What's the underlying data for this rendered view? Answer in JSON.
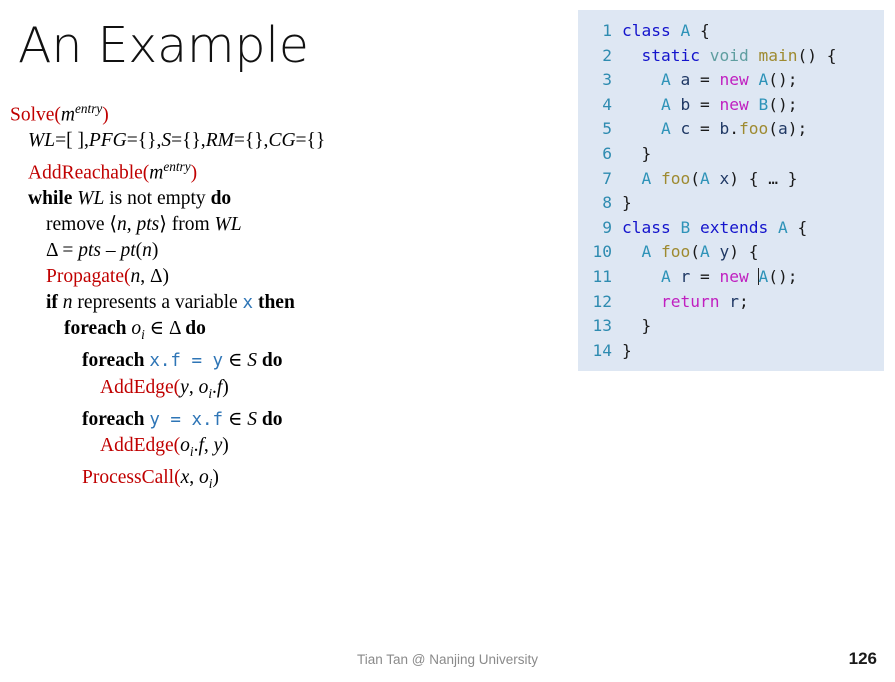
{
  "slide": {
    "title": "An Example",
    "footer": "Tian Tan @ Nanjing University",
    "page_number": "126",
    "colors": {
      "procedure_red": "#C00000",
      "code_blue": "#2E75B6",
      "code_panel_background": "#DEE7F3",
      "line_number": "#2E8BB0",
      "keyword": "#1414CC",
      "type": "#2E93B8",
      "method": "#9E8A30",
      "variable": "#1F3864",
      "new_keyword": "#C020C0",
      "footer_gray": "#8A8A8A"
    }
  },
  "algorithm": {
    "lines": [
      {
        "indent": 0,
        "parts": [
          {
            "text": "Solve(",
            "style": "fn"
          },
          {
            "text": "m",
            "style": "mathvar"
          },
          {
            "text": "entry",
            "style": "sup"
          },
          {
            "text": ")",
            "style": "fn"
          }
        ]
      },
      {
        "indent": 1,
        "parts": [
          {
            "text": "WL",
            "style": "it"
          },
          {
            "text": "=[ ],",
            "style": "plain"
          },
          {
            "text": "PFG",
            "style": "it"
          },
          {
            "text": "={},",
            "style": "plain"
          },
          {
            "text": "S",
            "style": "it"
          },
          {
            "text": "={},",
            "style": "plain"
          },
          {
            "text": "RM",
            "style": "it"
          },
          {
            "text": "={},",
            "style": "plain"
          },
          {
            "text": "CG",
            "style": "it"
          },
          {
            "text": "={}",
            "style": "plain"
          }
        ]
      },
      {
        "indent": 1,
        "parts": [
          {
            "text": "AddReachable(",
            "style": "fn"
          },
          {
            "text": "m",
            "style": "mathvar"
          },
          {
            "text": "entry",
            "style": "sup"
          },
          {
            "text": ")",
            "style": "fn"
          }
        ]
      },
      {
        "indent": 1,
        "parts": [
          {
            "text": "while ",
            "style": "kw"
          },
          {
            "text": "WL",
            "style": "it"
          },
          {
            "text": " is not empty ",
            "style": "plain"
          },
          {
            "text": "do",
            "style": "kw"
          }
        ]
      },
      {
        "indent": 2,
        "parts": [
          {
            "text": "remove ⟨",
            "style": "plain"
          },
          {
            "text": "n",
            "style": "it"
          },
          {
            "text": ", ",
            "style": "plain"
          },
          {
            "text": "pts",
            "style": "it"
          },
          {
            "text": "⟩ from ",
            "style": "plain"
          },
          {
            "text": "WL",
            "style": "it"
          }
        ]
      },
      {
        "indent": 2,
        "parts": [
          {
            "text": "Δ = ",
            "style": "plain"
          },
          {
            "text": "pts",
            "style": "it"
          },
          {
            "text": " – ",
            "style": "plain"
          },
          {
            "text": "pt",
            "style": "it"
          },
          {
            "text": "(",
            "style": "plain"
          },
          {
            "text": "n",
            "style": "it"
          },
          {
            "text": ")",
            "style": "plain"
          }
        ]
      },
      {
        "indent": 2,
        "parts": [
          {
            "text": "Propagate(",
            "style": "fn"
          },
          {
            "text": "n",
            "style": "it"
          },
          {
            "text": ", Δ)",
            "style": "plain"
          }
        ]
      },
      {
        "indent": 2,
        "parts": [
          {
            "text": "if ",
            "style": "kw"
          },
          {
            "text": "n",
            "style": "it"
          },
          {
            "text": " represents a variable ",
            "style": "plain"
          },
          {
            "text": "x",
            "style": "mono"
          },
          {
            "text": " ",
            "style": "plain"
          },
          {
            "text": "then",
            "style": "kw"
          }
        ]
      },
      {
        "indent": 3,
        "parts": [
          {
            "text": "foreach ",
            "style": "kw"
          },
          {
            "text": "o",
            "style": "it"
          },
          {
            "text": "i",
            "style": "sub"
          },
          {
            "text": " ∈ Δ ",
            "style": "plain"
          },
          {
            "text": "do",
            "style": "kw"
          }
        ]
      },
      {
        "indent": 4,
        "parts": [
          {
            "text": "foreach ",
            "style": "kw"
          },
          {
            "text": "x.f = y",
            "style": "mono"
          },
          {
            "text": " ∈ ",
            "style": "plain"
          },
          {
            "text": "S",
            "style": "it"
          },
          {
            "text": " ",
            "style": "plain"
          },
          {
            "text": "do",
            "style": "kw"
          }
        ]
      },
      {
        "indent": 5,
        "parts": [
          {
            "text": "AddEdge(",
            "style": "fn"
          },
          {
            "text": "y",
            "style": "it"
          },
          {
            "text": ", ",
            "style": "plain"
          },
          {
            "text": "o",
            "style": "it"
          },
          {
            "text": "i",
            "style": "sub"
          },
          {
            "text": ".",
            "style": "plain"
          },
          {
            "text": "f",
            "style": "it"
          },
          {
            "text": ")",
            "style": "plain"
          }
        ]
      },
      {
        "indent": 4,
        "parts": [
          {
            "text": "foreach ",
            "style": "kw"
          },
          {
            "text": "y = x.f",
            "style": "mono"
          },
          {
            "text": " ∈ ",
            "style": "plain"
          },
          {
            "text": "S",
            "style": "it"
          },
          {
            "text": " ",
            "style": "plain"
          },
          {
            "text": "do",
            "style": "kw"
          }
        ]
      },
      {
        "indent": 5,
        "parts": [
          {
            "text": "AddEdge(",
            "style": "fn"
          },
          {
            "text": "o",
            "style": "it"
          },
          {
            "text": "i",
            "style": "sub"
          },
          {
            "text": ".",
            "style": "plain"
          },
          {
            "text": "f",
            "style": "it"
          },
          {
            "text": ", ",
            "style": "plain"
          },
          {
            "text": "y",
            "style": "it"
          },
          {
            "text": ")",
            "style": "plain"
          }
        ]
      },
      {
        "indent": 4,
        "parts": [
          {
            "text": "ProcessCall(",
            "style": "fn"
          },
          {
            "text": "x",
            "style": "it"
          },
          {
            "text": ", ",
            "style": "plain"
          },
          {
            "text": "o",
            "style": "it"
          },
          {
            "text": "i",
            "style": "sub"
          },
          {
            "text": ")",
            "style": "plain"
          }
        ]
      }
    ]
  },
  "code": {
    "language": "java",
    "lines": [
      {
        "num": "1",
        "tokens": [
          {
            "t": "class ",
            "c": "c-kw"
          },
          {
            "t": "A",
            "c": "c-type"
          },
          {
            "t": " {",
            "c": "c-pun"
          }
        ]
      },
      {
        "num": "2",
        "tokens": [
          {
            "t": "  ",
            "c": "c-pun"
          },
          {
            "t": "static ",
            "c": "c-kw"
          },
          {
            "t": "void ",
            "c": "c-void"
          },
          {
            "t": "main",
            "c": "c-meth"
          },
          {
            "t": "() {",
            "c": "c-pun"
          }
        ]
      },
      {
        "num": "3",
        "tokens": [
          {
            "t": "    ",
            "c": "c-pun"
          },
          {
            "t": "A",
            "c": "c-type"
          },
          {
            "t": " ",
            "c": "c-pun"
          },
          {
            "t": "a",
            "c": "c-var"
          },
          {
            "t": " = ",
            "c": "c-pun"
          },
          {
            "t": "new ",
            "c": "c-new"
          },
          {
            "t": "A",
            "c": "c-type"
          },
          {
            "t": "();",
            "c": "c-pun"
          }
        ]
      },
      {
        "num": "4",
        "tokens": [
          {
            "t": "    ",
            "c": "c-pun"
          },
          {
            "t": "A",
            "c": "c-type"
          },
          {
            "t": " ",
            "c": "c-pun"
          },
          {
            "t": "b",
            "c": "c-var"
          },
          {
            "t": " = ",
            "c": "c-pun"
          },
          {
            "t": "new ",
            "c": "c-new"
          },
          {
            "t": "B",
            "c": "c-type"
          },
          {
            "t": "();",
            "c": "c-pun"
          }
        ]
      },
      {
        "num": "5",
        "tokens": [
          {
            "t": "    ",
            "c": "c-pun"
          },
          {
            "t": "A",
            "c": "c-type"
          },
          {
            "t": " ",
            "c": "c-pun"
          },
          {
            "t": "c",
            "c": "c-var"
          },
          {
            "t": " = ",
            "c": "c-pun"
          },
          {
            "t": "b",
            "c": "c-var"
          },
          {
            "t": ".",
            "c": "c-pun"
          },
          {
            "t": "foo",
            "c": "c-meth"
          },
          {
            "t": "(",
            "c": "c-pun"
          },
          {
            "t": "a",
            "c": "c-var"
          },
          {
            "t": ");",
            "c": "c-pun"
          }
        ]
      },
      {
        "num": "6",
        "tokens": [
          {
            "t": "  }",
            "c": "c-pun"
          }
        ]
      },
      {
        "num": "7",
        "tokens": [
          {
            "t": "  ",
            "c": "c-pun"
          },
          {
            "t": "A",
            "c": "c-type"
          },
          {
            "t": " ",
            "c": "c-pun"
          },
          {
            "t": "foo",
            "c": "c-meth"
          },
          {
            "t": "(",
            "c": "c-pun"
          },
          {
            "t": "A",
            "c": "c-type"
          },
          {
            "t": " ",
            "c": "c-pun"
          },
          {
            "t": "x",
            "c": "c-var"
          },
          {
            "t": ") { … }",
            "c": "c-pun"
          }
        ]
      },
      {
        "num": "8",
        "tokens": [
          {
            "t": "}",
            "c": "c-pun"
          }
        ]
      },
      {
        "num": "9",
        "tokens": [
          {
            "t": "class ",
            "c": "c-kw"
          },
          {
            "t": "B",
            "c": "c-type"
          },
          {
            "t": " ",
            "c": "c-pun"
          },
          {
            "t": "extends ",
            "c": "c-kw"
          },
          {
            "t": "A",
            "c": "c-type"
          },
          {
            "t": " {",
            "c": "c-pun"
          }
        ]
      },
      {
        "num": "10",
        "tokens": [
          {
            "t": "  ",
            "c": "c-pun"
          },
          {
            "t": "A",
            "c": "c-type"
          },
          {
            "t": " ",
            "c": "c-pun"
          },
          {
            "t": "foo",
            "c": "c-meth"
          },
          {
            "t": "(",
            "c": "c-pun"
          },
          {
            "t": "A",
            "c": "c-type"
          },
          {
            "t": " ",
            "c": "c-pun"
          },
          {
            "t": "y",
            "c": "c-var"
          },
          {
            "t": ") {",
            "c": "c-pun"
          }
        ]
      },
      {
        "num": "11",
        "tokens": [
          {
            "t": "    ",
            "c": "c-pun"
          },
          {
            "t": "A",
            "c": "c-type"
          },
          {
            "t": " ",
            "c": "c-pun"
          },
          {
            "t": "r",
            "c": "c-var"
          },
          {
            "t": " = ",
            "c": "c-pun"
          },
          {
            "t": "new ",
            "c": "c-new"
          },
          {
            "t": "",
            "c": "caret"
          },
          {
            "t": "A",
            "c": "c-type"
          },
          {
            "t": "();",
            "c": "c-pun"
          }
        ]
      },
      {
        "num": "12",
        "tokens": [
          {
            "t": "    ",
            "c": "c-pun"
          },
          {
            "t": "return ",
            "c": "c-new"
          },
          {
            "t": "r",
            "c": "c-var"
          },
          {
            "t": ";",
            "c": "c-pun"
          }
        ]
      },
      {
        "num": "13",
        "tokens": [
          {
            "t": "  }",
            "c": "c-pun"
          }
        ]
      },
      {
        "num": "14",
        "tokens": [
          {
            "t": "}",
            "c": "c-pun"
          }
        ]
      }
    ]
  }
}
